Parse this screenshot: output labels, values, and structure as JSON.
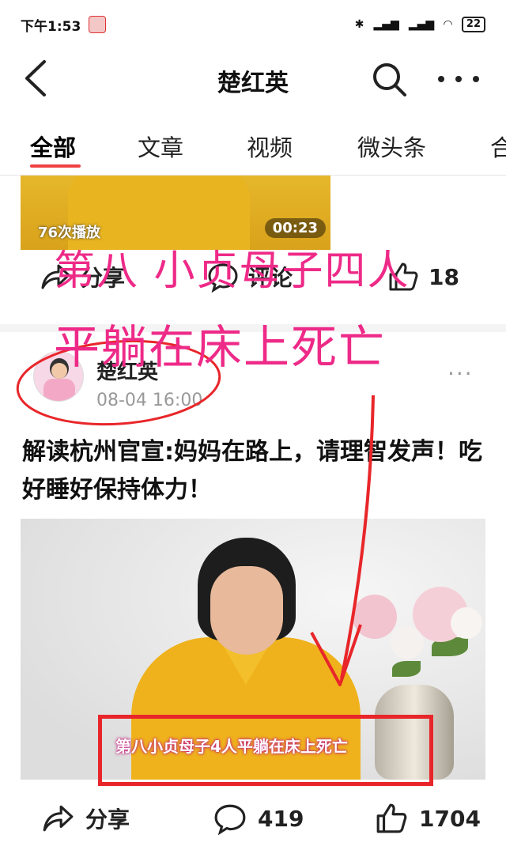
{
  "status_bar": {
    "time": "下午1:53",
    "battery": "22"
  },
  "nav": {
    "title": "楚红英"
  },
  "tabs": [
    {
      "label": "全部",
      "active": true
    },
    {
      "label": "文章"
    },
    {
      "label": "视频"
    },
    {
      "label": "微头条"
    },
    {
      "label": "合"
    }
  ],
  "prev_post": {
    "plays": "76次播放",
    "duration": "00:23",
    "share_label": "分享",
    "comment_label": "评论",
    "like_count": "18"
  },
  "post": {
    "author": "楚红英",
    "time": "08-04 16:00",
    "title": "解读杭州官宣:妈妈在路上，请理智发声！吃好睡好保持体力！",
    "video_caption": "第八小贞母子4人平躺在床上死亡",
    "share_label": "分享",
    "comment_count": "419",
    "like_count": "1704"
  },
  "overlay": {
    "line1": "第八 小贞母子四人",
    "line2": "平躺在床上死亡",
    "color": "#ee2a88"
  },
  "colors": {
    "accent": "#f04142",
    "annotation": "#e8262a"
  }
}
